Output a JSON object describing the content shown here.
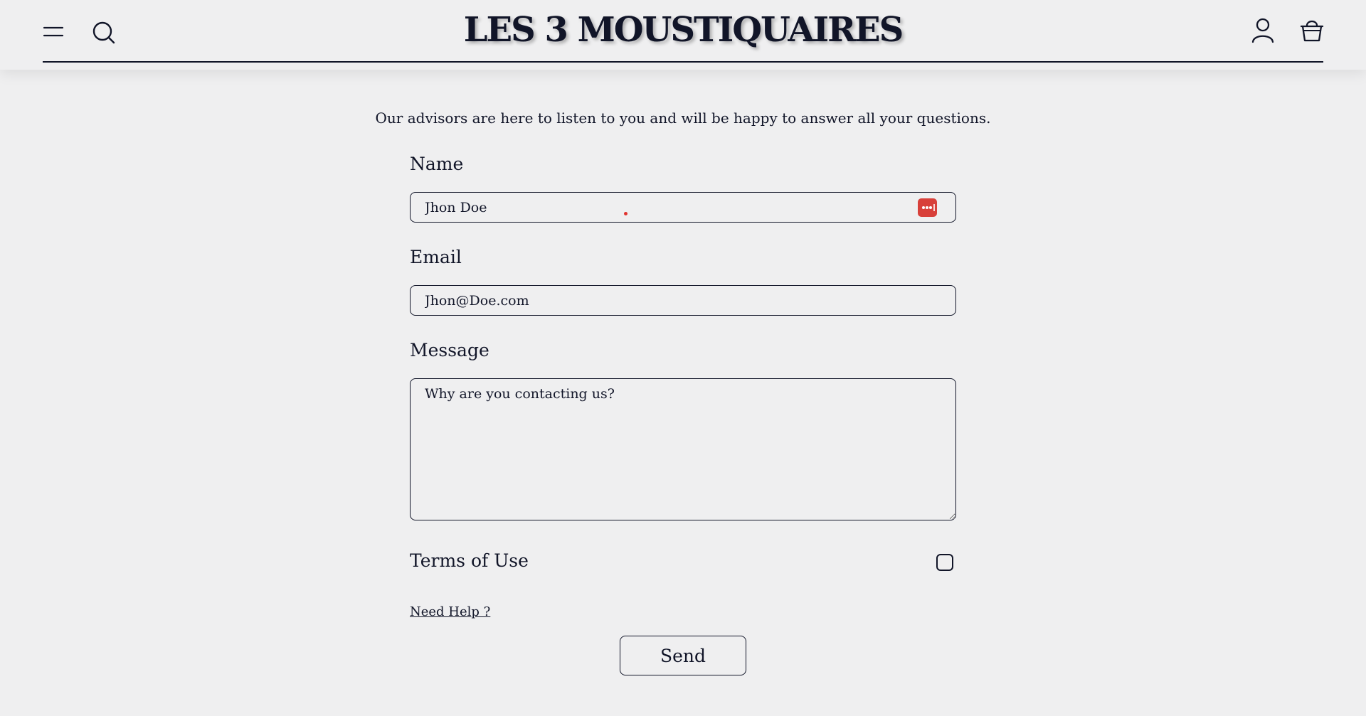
{
  "header": {
    "logo": "LES 3 MOUSTIQUAIRES",
    "icons": [
      "menu-icon",
      "search-icon",
      "user-icon",
      "basket-icon"
    ]
  },
  "contact": {
    "intro": "Our advisors are here to listen to you and will be happy to answer all your questions.",
    "name_label": "Name",
    "name_value": "Jhon Doe",
    "email_label": "Email",
    "email_value": "Jhon@Doe.com",
    "message_label": "Message",
    "message_placeholder": "Why are you contacting us?",
    "terms_label": "Terms of Use",
    "help_link": "Need Help ?",
    "send_label": "Send"
  },
  "colors": {
    "background": "#efeff0",
    "text": "#111528",
    "password_badge": "#d8403a"
  }
}
